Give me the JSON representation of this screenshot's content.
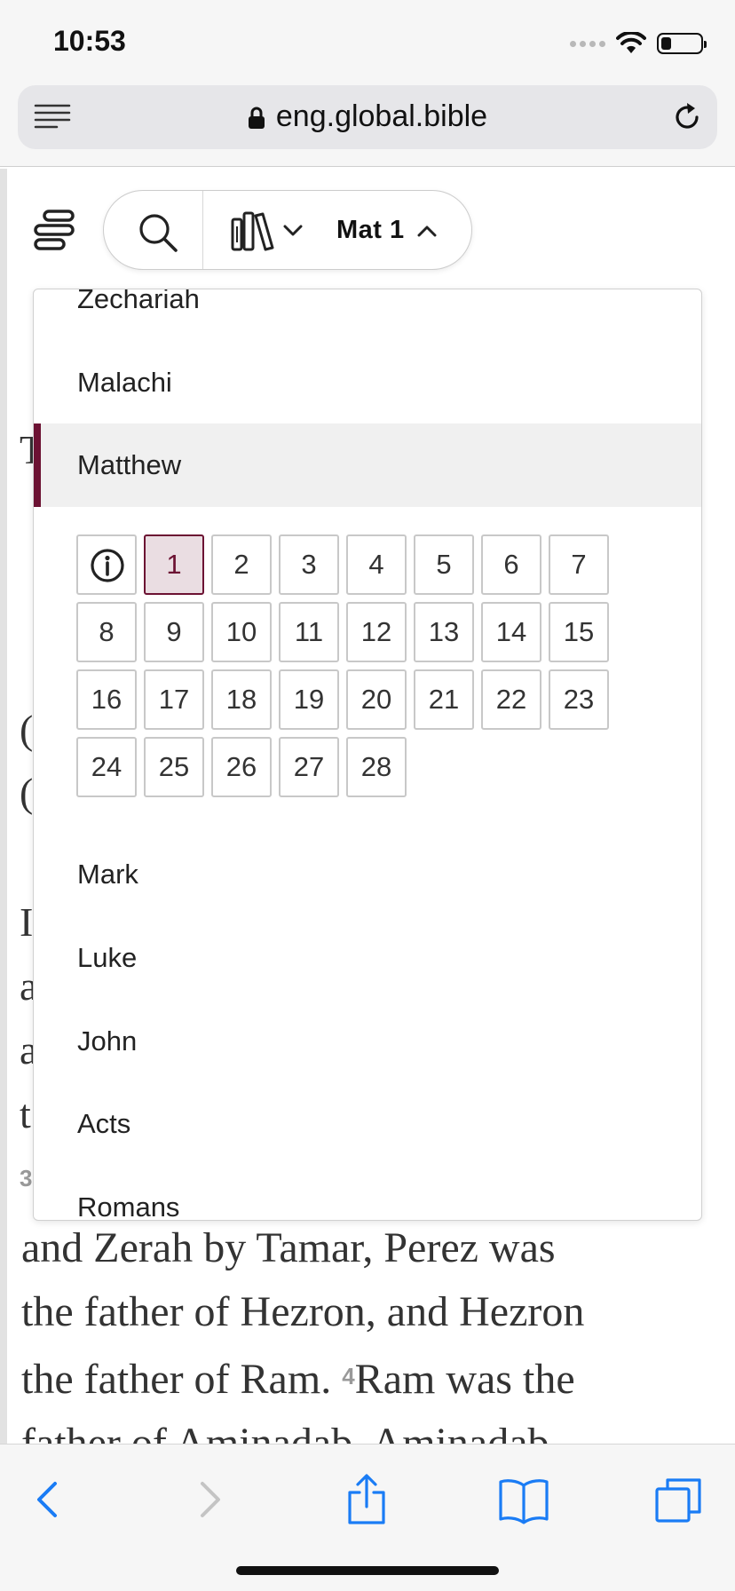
{
  "status_bar": {
    "time": "10:53",
    "battery_level": 0.25
  },
  "browser": {
    "url": "eng.global.bible"
  },
  "header": {
    "passage": "Mat 1"
  },
  "background_fragments": [
    "T",
    "(",
    "(",
    "I",
    "a",
    "a",
    "t",
    "3",
    "."
  ],
  "book_list": {
    "books_before": [
      "Zechariah",
      "Malachi"
    ],
    "selected_book": "Matthew",
    "books_after": [
      "Mark",
      "Luke",
      "John",
      "Acts",
      "Romans"
    ]
  },
  "chapters": {
    "items": [
      "1",
      "2",
      "3",
      "4",
      "5",
      "6",
      "7",
      "8",
      "9",
      "10",
      "11",
      "12",
      "13",
      "14",
      "15",
      "16",
      "17",
      "18",
      "19",
      "20",
      "21",
      "22",
      "23",
      "24",
      "25",
      "26",
      "27",
      "28"
    ],
    "current": "1"
  },
  "reading": {
    "line1": "and Zerah by Tamar, Perez was",
    "line2": "the father of Hezron, and Hezron",
    "line3_a": "the father of Ram. ",
    "verse4": "4",
    "line3_b": "Ram was the",
    "line4": "father of Aminadab. Aminadab"
  },
  "icons": {
    "reader": "reader-icon",
    "lock": "lock-icon",
    "reload": "reload-icon",
    "menu": "menu-icon",
    "search": "search-icon",
    "library": "library-icon",
    "info": "info-icon",
    "back": "back-icon",
    "forward": "forward-icon",
    "share": "share-icon",
    "bookmarks": "bookmarks-icon",
    "tabs": "tabs-icon"
  },
  "colors": {
    "accent": "#6c1233",
    "active_cell_bg": "#eadde2",
    "ios_blue": "#1a7cf5"
  }
}
